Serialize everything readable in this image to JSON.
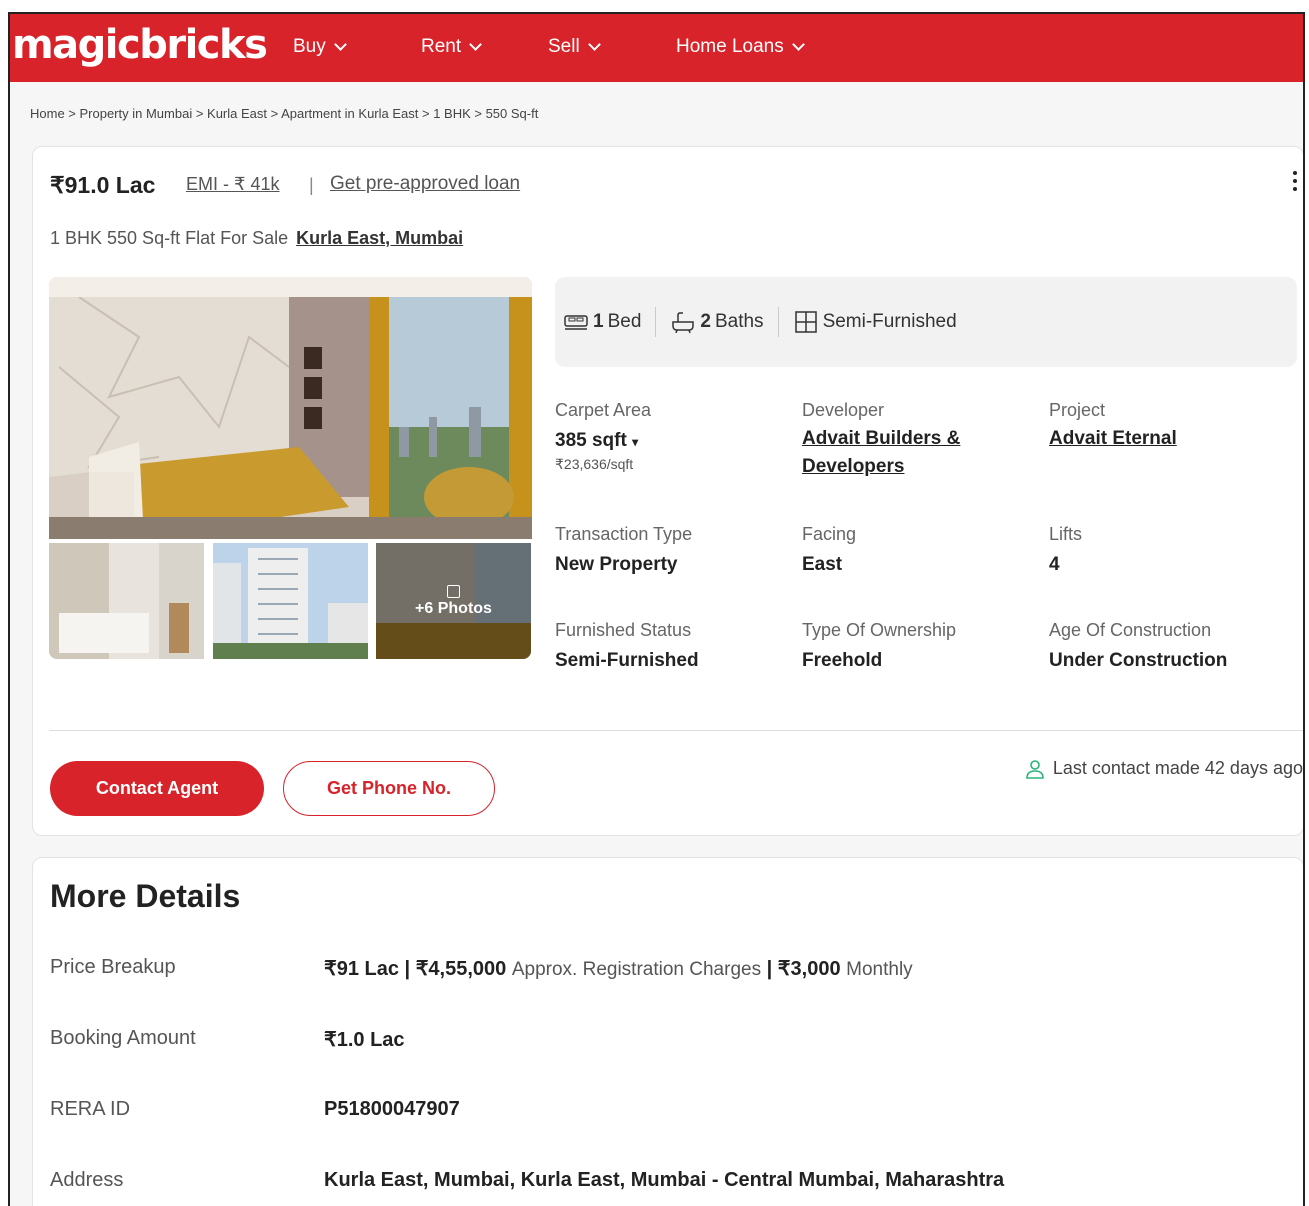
{
  "header": {
    "logo": "magicbricks",
    "nav": [
      {
        "label": "Buy"
      },
      {
        "label": "Rent"
      },
      {
        "label": "Sell"
      },
      {
        "label": "Home Loans"
      }
    ]
  },
  "breadcrumb": "Home > Property in Mumbai > Kurla East > Apartment in Kurla East > 1 BHK > 550 Sq-ft",
  "listing": {
    "price": "₹91.0 Lac",
    "emi": "EMI - ₹ 41k",
    "separator": "|",
    "preapproved": "Get pre-approved loan",
    "subtitle": "1 BHK 550 Sq-ft Flat For Sale",
    "location": "Kurla East, Mumbai",
    "photos_more": "+6 Photos",
    "highlights": {
      "bed_count": "1",
      "bed_label": "Bed",
      "bath_count": "2",
      "bath_label": "Baths",
      "furnishing": "Semi-Furnished"
    },
    "summary": {
      "carpet_label": "Carpet Area",
      "carpet_value": "385 sqft",
      "carpet_rate": "₹23,636/sqft",
      "developer_label": "Developer",
      "developer_value": "Advait Builders & Developers",
      "project_label": "Project",
      "project_value": "Advait Eternal",
      "transaction_label": "Transaction Type",
      "transaction_value": "New Property",
      "facing_label": "Facing",
      "facing_value": "East",
      "lifts_label": "Lifts",
      "lifts_value": "4",
      "furnished_label": "Furnished Status",
      "furnished_value": "Semi-Furnished",
      "ownership_label": "Type Of Ownership",
      "ownership_value": "Freehold",
      "age_label": "Age Of Construction",
      "age_value": "Under Construction"
    },
    "contact_agent": "Contact Agent",
    "get_phone": "Get Phone No.",
    "last_contact": "Last contact made 42 days ago"
  },
  "more_details": {
    "title": "More Details",
    "price_breakup_label": "Price Breakup",
    "price_breakup_price": "₹91 Lac | ₹4,55,000",
    "price_breakup_reg": "Approx. Registration Charges",
    "price_breakup_monthly": "| ₹3,000",
    "price_breakup_monthly_label": "Monthly",
    "booking_label": "Booking Amount",
    "booking_value": "₹1.0 Lac",
    "rera_label": "RERA ID",
    "rera_value": "P51800047907",
    "address_label": "Address",
    "address_value": "Kurla East, Mumbai, Kurla East, Mumbai - Central Mumbai, Maharashtra"
  },
  "colors": {
    "brand": "#d8232a",
    "text": "#222222",
    "muted": "#666666",
    "success_icon": "#2db37a"
  },
  "icons": [
    "bed-icon",
    "bath-icon",
    "furnishing-icon",
    "user-icon",
    "gallery-icon",
    "kebab-menu-icon",
    "chevron-down-icon"
  ]
}
